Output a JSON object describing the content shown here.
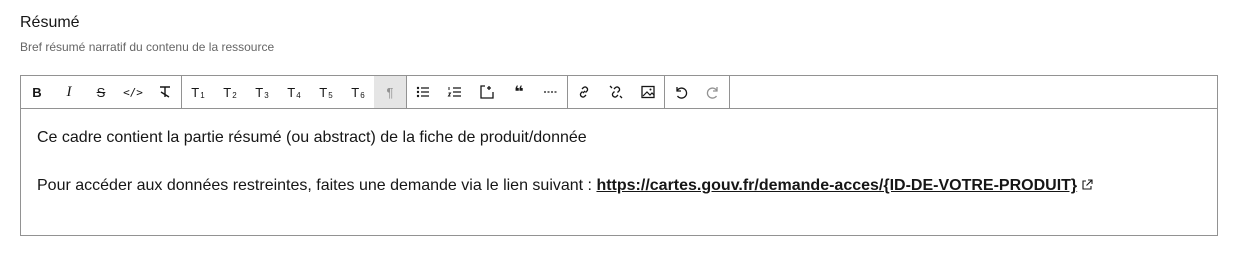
{
  "field": {
    "label": "Résumé",
    "hint": "Bref résumé narratif du contenu de la ressource"
  },
  "toolbar": {
    "bold": "B",
    "italic": "I",
    "strike": "S",
    "code": "</>",
    "h1_main": "T",
    "h1_sub": "1",
    "h2_main": "T",
    "h2_sub": "2",
    "h3_main": "T",
    "h3_sub": "3",
    "h4_main": "T",
    "h4_sub": "4",
    "h5_main": "T",
    "h5_sub": "5",
    "h6_main": "T",
    "h6_sub": "6",
    "paragraph": "¶",
    "quote": "❝"
  },
  "content": {
    "paragraph1": "Ce cadre contient la partie résumé (ou abstract) de la fiche de produit/donnée",
    "paragraph2_text": "Pour accéder aux données restreintes, faites une demande via le lien suivant : ",
    "link_text": "https://cartes.gouv.fr/demande-acces/{ID-DE-VOTRE-PRODUIT}"
  }
}
